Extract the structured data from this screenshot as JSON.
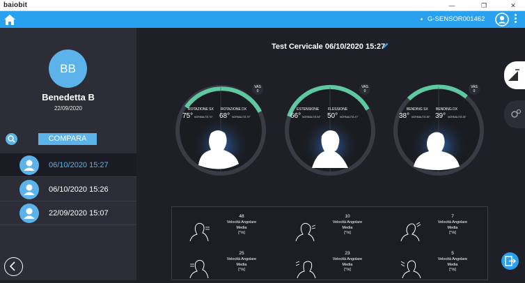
{
  "window": {
    "app_title": "baiobit",
    "minimize": "—",
    "maximize": "❐",
    "close": "✕"
  },
  "topbar": {
    "device_id": "G-SENSOR001462"
  },
  "patient": {
    "initials": "BB",
    "name": "Benedetta B",
    "date": "22/09/2020"
  },
  "sidebar": {
    "compare_label": "COMPARA",
    "sessions": [
      {
        "label": "06/10/2020 15:27",
        "selected": true
      },
      {
        "label": "06/10/2020 15:26",
        "selected": false
      },
      {
        "label": "22/09/2020 15:07",
        "selected": false
      }
    ]
  },
  "test": {
    "title": "Test Cervicale 06/10/2020 15:27"
  },
  "gauges": [
    {
      "vas_label": "VAS",
      "vas_value": "0",
      "left": {
        "label": "ROTAZIONE SX",
        "value": "75°",
        "norm": "NORMALITÀ 70°"
      },
      "right": {
        "label": "ROTAZIONE DX",
        "value": "68°",
        "norm": "NORMALITÀ 70°"
      }
    },
    {
      "vas_label": "VAS",
      "vas_value": "0",
      "left": {
        "label": "ESTENSIONE",
        "value": "66°",
        "norm": "NORMALITÀ 54°"
      },
      "right": {
        "label": "FLESSIONE",
        "value": "50°",
        "norm": "NORMALITÀ 47°"
      }
    },
    {
      "vas_label": "VAS",
      "vas_value": "0",
      "left": {
        "label": "BENDING SX",
        "value": "38°",
        "norm": "NORMALITÀ 35°"
      },
      "right": {
        "label": "BENDING DX",
        "value": "39°",
        "norm": "NORMALITÀ 35°"
      }
    }
  ],
  "metrics": [
    {
      "value": "48",
      "label1": "Velocità Angolare",
      "label2": "Media",
      "unit": "[°/s]"
    },
    {
      "value": "10",
      "label1": "Velocità Angolare",
      "label2": "Media",
      "unit": "[°/s]"
    },
    {
      "value": "7",
      "label1": "Velocità Angolare",
      "label2": "Media",
      "unit": "[°/s]"
    },
    {
      "value": "25",
      "label1": "Velocità Angolare",
      "label2": "Media",
      "unit": "[°/s]"
    },
    {
      "value": "23",
      "label1": "Velocità Angolare",
      "label2": "Media",
      "unit": "[°/s]"
    },
    {
      "value": "5",
      "label1": "Velocità Angolare",
      "label2": "Media",
      "unit": "[°/s]"
    }
  ],
  "colors": {
    "accent": "#2aa1ef",
    "avatar": "#5cb3ea",
    "arc": "#5ec8a0",
    "track": "#3a3b45",
    "background": "#1e1f27",
    "sidebar": "#2c2d36"
  },
  "icons": {
    "home": "home-icon",
    "user": "user-icon",
    "search": "search-icon",
    "back": "chevron-left-icon",
    "edit": "pencil-icon",
    "exit": "exit-icon"
  }
}
